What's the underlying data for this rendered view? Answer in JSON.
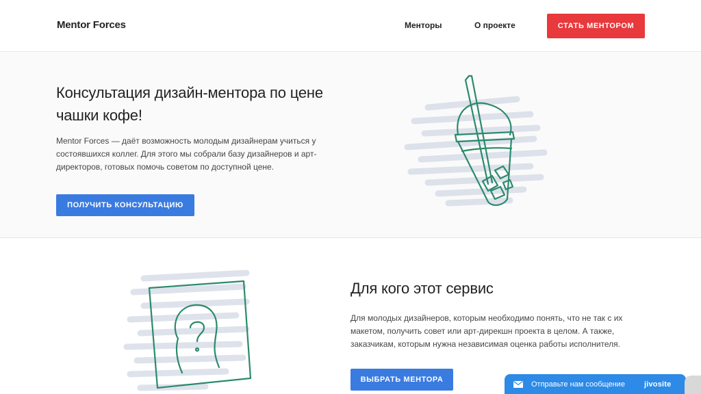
{
  "header": {
    "logo": "Mentor Forces",
    "nav": [
      {
        "label": "Менторы"
      },
      {
        "label": "О проекте"
      }
    ],
    "cta_label": "СТАТЬ МЕНТОРОМ"
  },
  "hero": {
    "title": "Консультация дизайн-ментора по цене чашки кофе!",
    "text": "Mentor Forces — даёт возможность молодым дизайнерам учиться у состоявшихся коллег. Для этого мы собрали базу дизайнеров и арт-директоров, готовых помочь советом по доступной цене.",
    "button_label": "ПОЛУЧИТЬ КОНСУЛЬТАЦИЮ"
  },
  "audience": {
    "title": "Для кого этот сервис",
    "text": "Для молодых дизайнеров, которым необходимо понять, что не так с их макетом, получить совет или арт-дирекшн проекта в целом. А также, заказчикам, которым нужна независимая оценка работы исполнителя.",
    "button_label": "ВЫБРАТЬ МЕНТОРА"
  },
  "chat": {
    "label": "Отправьте нам сообщение",
    "brand": "jivosite"
  },
  "colors": {
    "accent_red": "#e8393c",
    "accent_blue": "#3a7be0",
    "illustration_green": "#2a8a6a",
    "illustration_scribble": "#d9dde8",
    "chat_blue": "#2d8ae6"
  }
}
